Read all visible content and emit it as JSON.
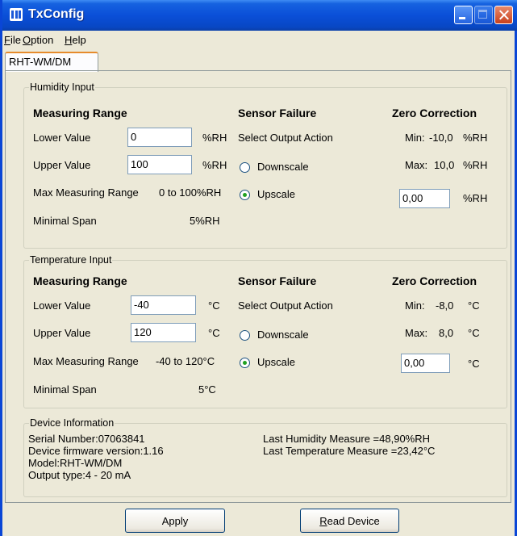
{
  "window": {
    "title": "TxConfig"
  },
  "menu": {
    "items": [
      "File",
      "Option",
      "Help"
    ]
  },
  "tab": {
    "label": "RHT-WM/DM"
  },
  "humidity": {
    "legend": "Humidity Input",
    "measuring_range": "Measuring Range",
    "lower_label": "Lower Value",
    "lower_value": "0",
    "lower_unit": "%RH",
    "upper_label": "Upper Value",
    "upper_value": "100",
    "upper_unit": "%RH",
    "max_range_label": "Max Measuring Range",
    "max_range_value": "0 to 100%RH",
    "min_span_label": "Minimal Span",
    "min_span_value": "5%RH",
    "sensor_failure": "Sensor Failure",
    "select_output": "Select Output Action",
    "downscale": "Downscale",
    "upscale": "Upscale",
    "selected_action": "Upscale",
    "zero_correction": "Zero Correction",
    "min_label": "Min:",
    "min_value": "-10,0",
    "min_unit": "%RH",
    "max_label": "Max:",
    "max_value": "10,0",
    "max_unit": "%RH",
    "correction_value": "0,00",
    "correction_unit": "%RH"
  },
  "temperature": {
    "legend": "Temperature Input",
    "measuring_range": "Measuring Range",
    "lower_label": "Lower Value",
    "lower_value": "-40",
    "lower_unit": "°C",
    "upper_label": "Upper Value",
    "upper_value": "120",
    "upper_unit": "°C",
    "max_range_label": "Max Measuring Range",
    "max_range_value": "-40 to 120°C",
    "min_span_label": "Minimal Span",
    "min_span_value": "5°C",
    "sensor_failure": "Sensor Failure",
    "select_output": "Select Output Action",
    "downscale": "Downscale",
    "upscale": "Upscale",
    "selected_action": "Upscale",
    "zero_correction": "Zero Correction",
    "min_label": "Min:",
    "min_value": "-8,0",
    "min_unit": "°C",
    "max_label": "Max:",
    "max_value": "8,0",
    "max_unit": "°C",
    "correction_value": "0,00",
    "correction_unit": "°C"
  },
  "device": {
    "legend": "Device Information",
    "serial": "Serial Number:07063841",
    "firmware": "Device firmware version:1.16",
    "model": "Model:RHT-WM/DM",
    "output": "Output type:4 - 20 mA",
    "last_humidity": "Last Humidity Measure =48,90%RH",
    "last_temperature": "Last Temperature Measure =23,42°C"
  },
  "buttons": {
    "apply": "Apply",
    "read_device": "Read Device"
  },
  "colors": {
    "titlebar": "#0a4fd8",
    "face": "#ece9d8",
    "tab_accent": "#e68b2c",
    "radio_dot": "#21a121"
  }
}
